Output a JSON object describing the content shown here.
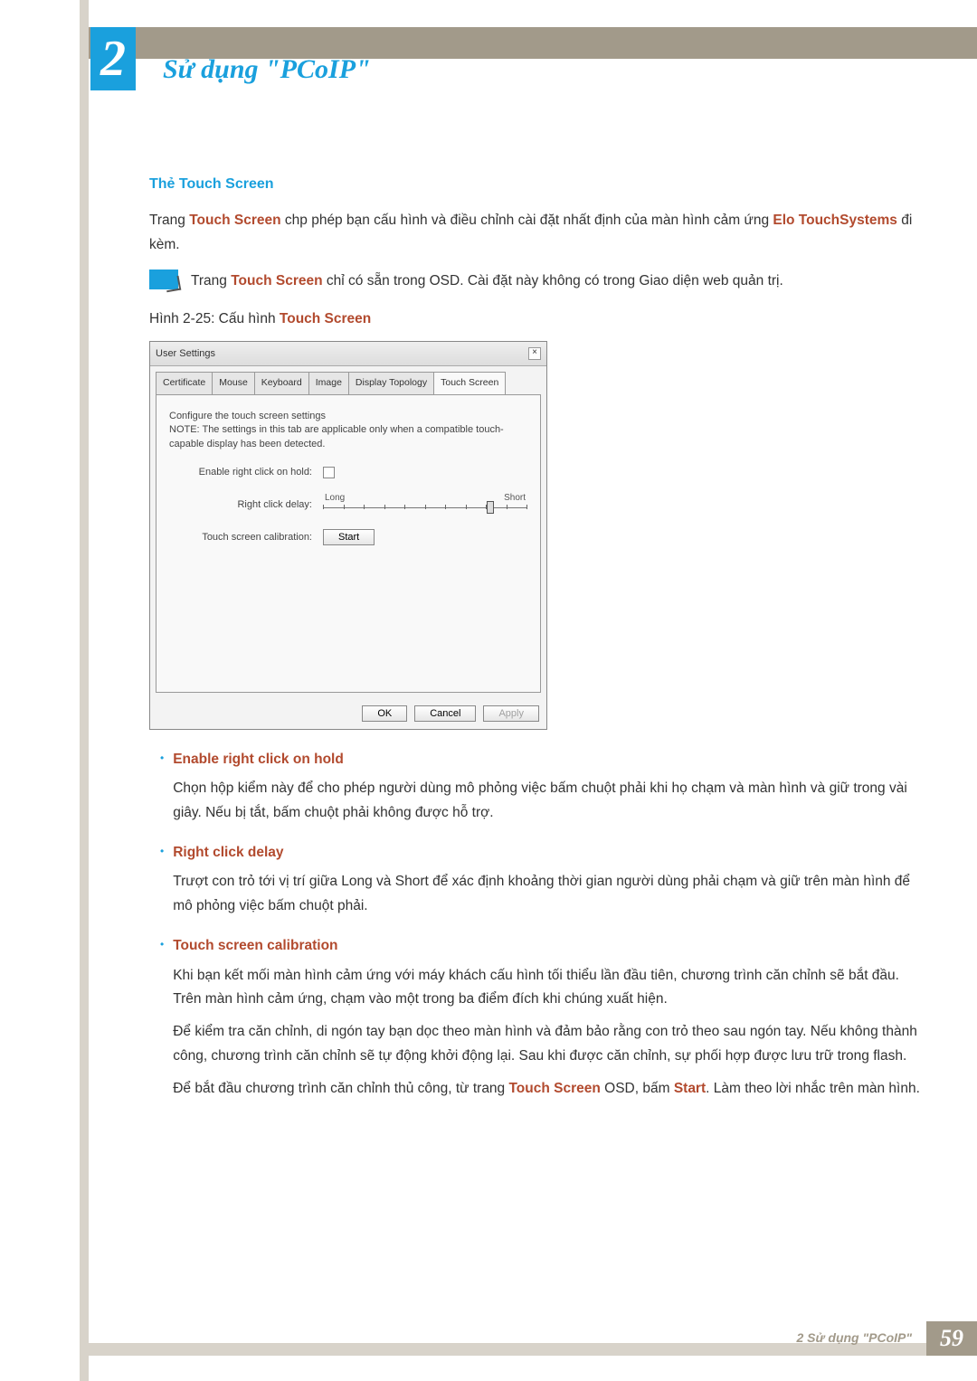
{
  "chapter": {
    "number": "2",
    "title": "Sử dụng \"PCoIP\""
  },
  "section_heading": "Thẻ Touch Screen",
  "intro": {
    "pre": "Trang ",
    "touch_screen": "Touch Screen",
    "mid": " chp phép bạn cấu hình và điều chỉnh cài đặt nhất định của màn hình cảm ứng ",
    "elo": "Elo TouchSystems",
    "post": " đi kèm."
  },
  "note": {
    "pre": "Trang ",
    "touch_screen": "Touch Screen",
    "post": " chỉ có sẵn trong OSD. Cài đặt này không có trong Giao diện web quản trị."
  },
  "caption": {
    "pre": "Hình 2-25: Cấu hình ",
    "touch_screen": "Touch Screen"
  },
  "dialog": {
    "title": "User Settings",
    "close": "×",
    "tabs": [
      "Certificate",
      "Mouse",
      "Keyboard",
      "Image",
      "Display Topology",
      "Touch Screen"
    ],
    "active_tab": 5,
    "panel_text_1": "Configure the touch screen settings",
    "panel_text_2": "NOTE: The settings in this tab are applicable only when a compatible touch-capable display has been detected.",
    "row_enable": "Enable right click on hold:",
    "row_delay": "Right click delay:",
    "slider_long": "Long",
    "slider_short": "Short",
    "row_calibration": "Touch screen calibration:",
    "start_btn": "Start",
    "ok": "OK",
    "cancel": "Cancel",
    "apply": "Apply"
  },
  "bullets": [
    {
      "title": "Enable right click on hold",
      "paras": [
        "Chọn hộp kiểm này để cho phép người dùng mô phỏng việc bấm chuột phải khi họ chạm và màn hình và giữ trong vài giây. Nếu bị tắt, bấm chuột phải không được hỗ trợ."
      ]
    },
    {
      "title": "Right click delay",
      "paras": [
        "Trượt con trỏ tới vị trí giữa Long và Short để xác định khoảng thời gian người dùng phải chạm và giữ trên màn hình để mô phỏng việc bấm chuột phải."
      ]
    },
    {
      "title": "Touch screen calibration",
      "paras": [
        "Khi bạn kết mối màn hình cảm ứng với máy khách cấu hình tối thiểu lần đầu tiên, chương trình căn chỉnh sẽ bắt đầu. Trên màn hình cảm ứng, chạm vào một trong ba điểm đích khi chúng xuất hiện.",
        "Để kiểm tra căn chỉnh, di ngón tay bạn dọc theo màn hình và đảm bảo rằng con trỏ theo sau ngón tay. Nếu không thành công, chương trình căn chỉnh sẽ tự động khởi động lại. Sau khi được căn chỉnh, sự phối hợp được lưu trữ trong flash."
      ],
      "last_para": {
        "p1": "Để bắt đầu chương trình căn chỉnh thủ công, từ trang ",
        "ts": "Touch Screen",
        "p2": " OSD, bấm ",
        "start": "Start",
        "p3": ". Làm theo lời nhắc trên màn hình."
      }
    }
  ],
  "footer": {
    "label": "2 Sử dụng \"PCoIP\"",
    "page": "59"
  }
}
